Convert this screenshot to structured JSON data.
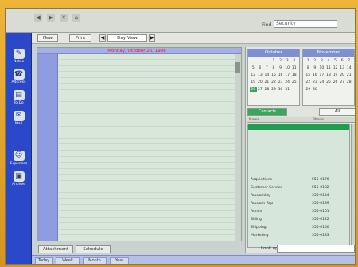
{
  "window": {
    "nav_buttons": [
      "◀",
      "▶",
      "✕",
      "⌂"
    ],
    "find_label": "Find",
    "find_value": "Security"
  },
  "toolbar": {
    "btn1": "New",
    "btn2": "Print",
    "prev": "◀",
    "selector_value": "Day View",
    "next": "▶"
  },
  "dock": {
    "items": [
      {
        "label": "Notes",
        "icon": "calendar-icon",
        "glyph": "✎"
      },
      {
        "label": "Address",
        "icon": "phone-icon",
        "glyph": "☎"
      },
      {
        "label": "To Do",
        "icon": "book-icon",
        "glyph": "▤"
      },
      {
        "label": "Mail",
        "icon": "mail-icon",
        "glyph": "✉"
      },
      {
        "label": "Expenses",
        "icon": "people-icon",
        "glyph": "☺"
      },
      {
        "label": "Archive",
        "icon": "archive-icon",
        "glyph": "▣"
      }
    ]
  },
  "document": {
    "title": "Monday, October 26, 1998"
  },
  "bottom": {
    "btn1": "Attachment",
    "btn2": "Schedule"
  },
  "status": {
    "cells": [
      "Today",
      "Week",
      "Month",
      "Year"
    ]
  },
  "calendar": {
    "left": {
      "month": "October",
      "days": [
        "",
        "",
        "",
        "1",
        "2",
        "3",
        "4",
        "5",
        "6",
        "7",
        "8",
        "9",
        "10",
        "11",
        "12",
        "13",
        "14",
        "15",
        "16",
        "17",
        "18",
        "19",
        "20",
        "21",
        "22",
        "23",
        "24",
        "25",
        "26",
        "27",
        "28",
        "29",
        "30",
        "31"
      ],
      "today_index": 28
    },
    "right": {
      "month": "November",
      "days": [
        "1",
        "2",
        "3",
        "4",
        "5",
        "6",
        "7",
        "8",
        "9",
        "10",
        "11",
        "12",
        "13",
        "14",
        "15",
        "16",
        "17",
        "18",
        "19",
        "20",
        "21",
        "22",
        "23",
        "24",
        "25",
        "26",
        "27",
        "28",
        "29",
        "30"
      ]
    }
  },
  "contacts": {
    "tab_active": "Contacts",
    "tab_other": "All",
    "header_name": "Name",
    "header_value": "Phone",
    "rows": [
      {
        "name": "",
        "value": ""
      },
      {
        "name": "Acquisitions",
        "value": "555-0176"
      },
      {
        "name": "Customer Service",
        "value": "555-0182"
      },
      {
        "name": "Accounting",
        "value": "555-0144"
      },
      {
        "name": "Account Rep",
        "value": "555-0199"
      },
      {
        "name": "Admin",
        "value": "555-0101"
      },
      {
        "name": "Billing",
        "value": "555-0122"
      },
      {
        "name": "Shipping",
        "value": "555-0150"
      },
      {
        "name": "Marketing",
        "value": "555-0133"
      }
    ],
    "lookup_label": "Look up"
  },
  "colors": {
    "dock": "#2b48c8",
    "selection": "#1f9e4e",
    "title_text": "#dd2222"
  }
}
